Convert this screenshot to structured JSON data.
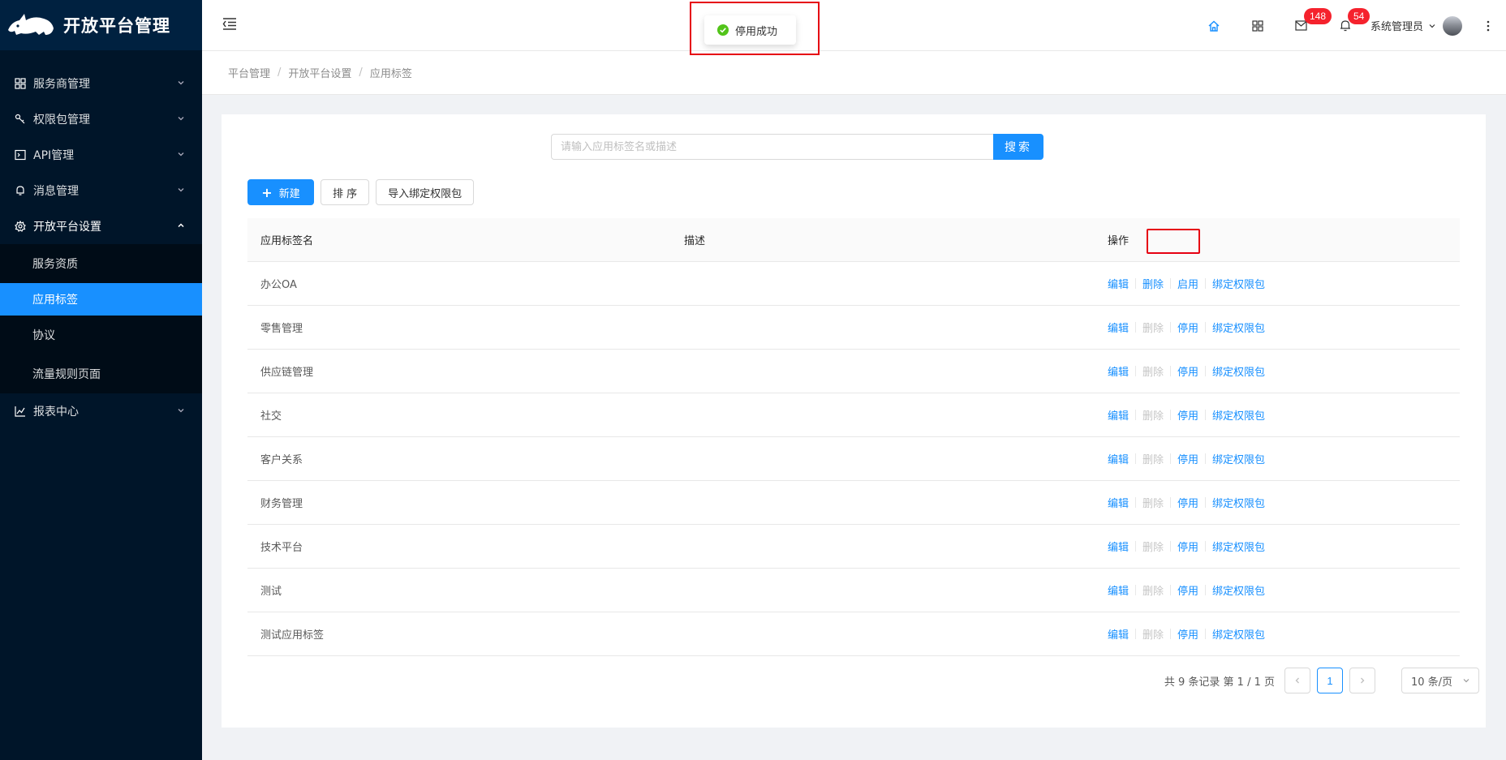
{
  "app": {
    "title": "开放平台管理"
  },
  "sidebar": {
    "menu": [
      {
        "label": "服务商管理",
        "icon": "cluster-icon"
      },
      {
        "label": "权限包管理",
        "icon": "key-icon"
      },
      {
        "label": "API管理",
        "icon": "api-icon"
      },
      {
        "label": "消息管理",
        "icon": "bell-icon"
      },
      {
        "label": "开放平台设置",
        "icon": "gear-icon",
        "open": true
      },
      {
        "label": "报表中心",
        "icon": "line-chart-icon"
      }
    ],
    "submenu": [
      {
        "label": "服务资质"
      },
      {
        "label": "应用标签",
        "active": true
      },
      {
        "label": "协议"
      },
      {
        "label": "流量规则页面"
      }
    ]
  },
  "header": {
    "mail_badge": "148",
    "bell_badge": "54",
    "user_name": "系统管理员"
  },
  "toast": {
    "message": "停用成功"
  },
  "breadcrumb": [
    "平台管理",
    "开放平台设置",
    "应用标签"
  ],
  "search": {
    "placeholder": "请输入应用标签名或描述",
    "value": "",
    "button": "搜索"
  },
  "toolbar": {
    "new": "新建",
    "sort": "排 序",
    "import": "导入绑定权限包"
  },
  "table": {
    "columns": [
      "应用标签名",
      "描述",
      "操作"
    ],
    "rows": [
      {
        "name": "办公OA",
        "desc": "",
        "toggle": "启用",
        "delete_enabled": true
      },
      {
        "name": "零售管理",
        "desc": "",
        "toggle": "停用",
        "delete_enabled": false
      },
      {
        "name": "供应链管理",
        "desc": "",
        "toggle": "停用",
        "delete_enabled": false
      },
      {
        "name": "社交",
        "desc": "",
        "toggle": "停用",
        "delete_enabled": false
      },
      {
        "name": "客户关系",
        "desc": "",
        "toggle": "停用",
        "delete_enabled": false
      },
      {
        "name": "财务管理",
        "desc": "",
        "toggle": "停用",
        "delete_enabled": false
      },
      {
        "name": "技术平台",
        "desc": "",
        "toggle": "停用",
        "delete_enabled": false
      },
      {
        "name": "测试",
        "desc": "",
        "toggle": "停用",
        "delete_enabled": false
      },
      {
        "name": "测试应用标签",
        "desc": "",
        "toggle": "停用",
        "delete_enabled": false
      }
    ],
    "actions": {
      "edit": "编辑",
      "delete": "删除",
      "bind": "绑定权限包"
    }
  },
  "pagination": {
    "summary": "共 9 条记录 第 1 / 1 页",
    "current": "1",
    "page_size": "10 条/页"
  },
  "colors": {
    "primary": "#1890ff",
    "sidebar": "#001529",
    "highlight": "#e60012",
    "badge": "#f5222d"
  }
}
